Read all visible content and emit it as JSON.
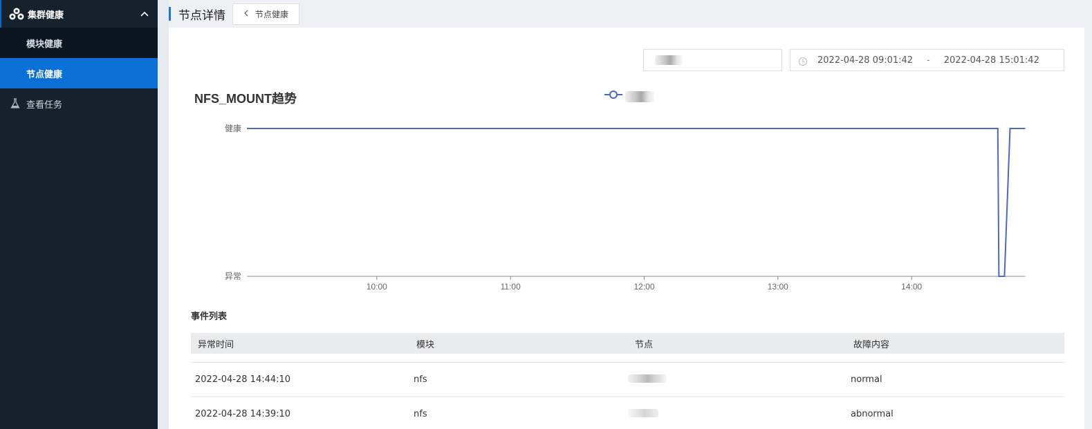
{
  "sidebar": {
    "group": {
      "label": "集群健康",
      "icon": "cluster-icon",
      "expanded": true
    },
    "sub_items": [
      {
        "label": "模块健康",
        "active": false
      },
      {
        "label": "节点健康",
        "active": true
      }
    ],
    "items": [
      {
        "label": "查看任务",
        "icon": "flask-icon"
      }
    ]
  },
  "header": {
    "title": "节点详情",
    "back_label": "节点健康"
  },
  "filters": {
    "date_start": "2022-04-28 09:01:42",
    "date_separator": "-",
    "date_end": "2022-04-28 15:01:42"
  },
  "chart_data": {
    "type": "line",
    "title": "NFS_MOUNT趋势",
    "y_categories": [
      "异常",
      "健康"
    ],
    "x_ticks": [
      "10:00",
      "11:00",
      "12:00",
      "13:00",
      "14:00"
    ],
    "x_range": [
      "09:01:42",
      "15:01:42"
    ],
    "series": [
      {
        "points": [
          {
            "x": "09:01:42",
            "y": "健康"
          },
          {
            "x": "14:38:40",
            "y": "健康"
          },
          {
            "x": "14:39:10",
            "y": "异常"
          },
          {
            "x": "14:41:40",
            "y": "异常"
          },
          {
            "x": "14:44:10",
            "y": "健康"
          },
          {
            "x": "14:51:00",
            "y": "健康"
          }
        ]
      }
    ],
    "color": "#4a67c9",
    "grid": false
  },
  "events": {
    "title": "事件列表",
    "columns": [
      "异常时间",
      "模块",
      "节点",
      "故障内容"
    ],
    "rows": [
      {
        "time": "2022-04-28 14:44:10",
        "module": "nfs",
        "content": "normal"
      },
      {
        "time": "2022-04-28 14:39:10",
        "module": "nfs",
        "content": "abnormal"
      }
    ]
  }
}
